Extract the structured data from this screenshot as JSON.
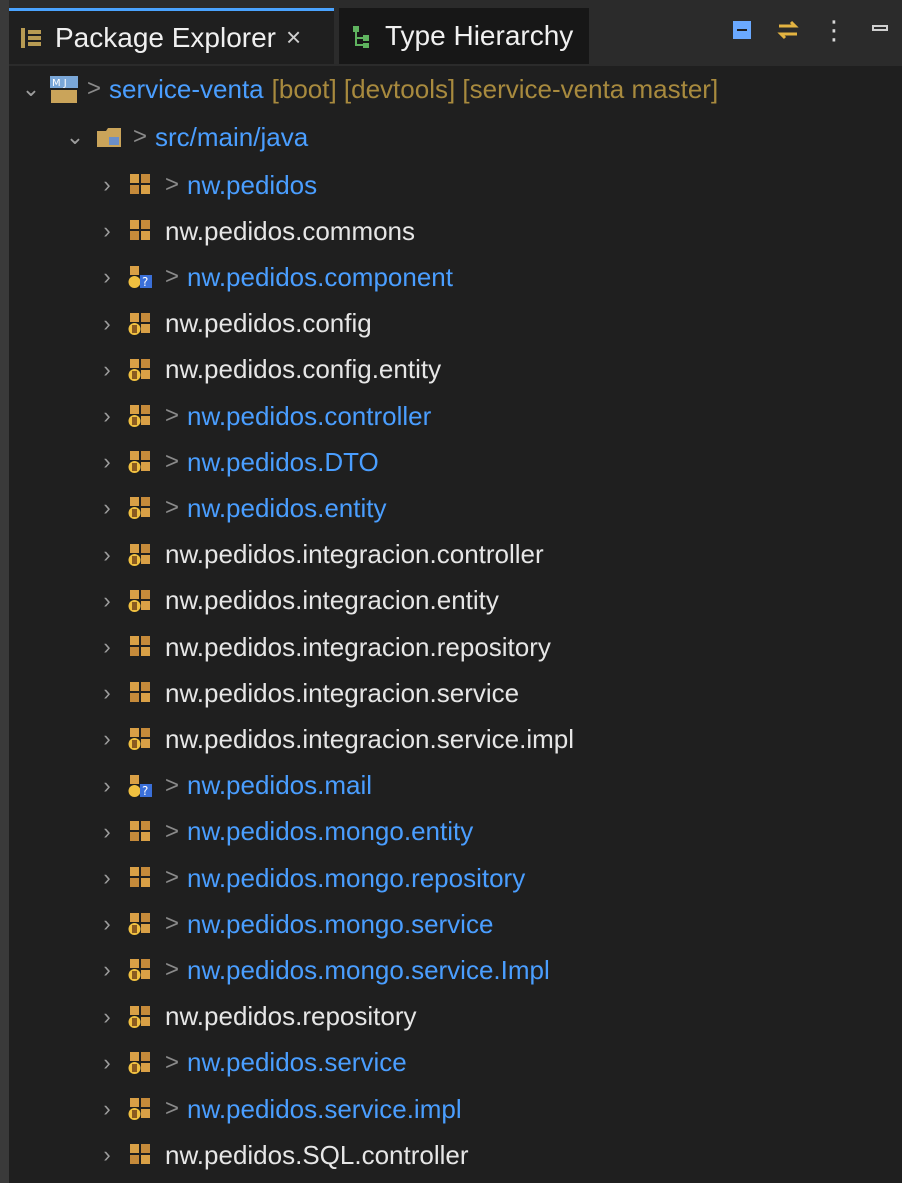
{
  "tabs": [
    {
      "label": "Package Explorer",
      "active": true
    },
    {
      "label": "Type Hierarchy",
      "active": false
    }
  ],
  "project": {
    "name": "service-venta",
    "decorations": "[boot] [devtools] [service-venta master]",
    "dirty_marker": ">"
  },
  "source_folder": {
    "name": "src/main/java",
    "dirty_marker": ">"
  },
  "packages": [
    {
      "name": "nw.pedidos",
      "dirty": true,
      "icon": "package-plain-icon"
    },
    {
      "name": "nw.pedidos.commons",
      "dirty": false,
      "icon": "package-plain-icon"
    },
    {
      "name": "nw.pedidos.component",
      "dirty": true,
      "icon": "package-question-icon"
    },
    {
      "name": "nw.pedidos.config",
      "dirty": false,
      "icon": "package-java-icon"
    },
    {
      "name": "nw.pedidos.config.entity",
      "dirty": false,
      "icon": "package-java-icon"
    },
    {
      "name": "nw.pedidos.controller",
      "dirty": true,
      "icon": "package-java-icon"
    },
    {
      "name": "nw.pedidos.DTO",
      "dirty": true,
      "icon": "package-java-icon"
    },
    {
      "name": "nw.pedidos.entity",
      "dirty": true,
      "icon": "package-java-icon"
    },
    {
      "name": "nw.pedidos.integracion.controller",
      "dirty": false,
      "icon": "package-java-icon"
    },
    {
      "name": "nw.pedidos.integracion.entity",
      "dirty": false,
      "icon": "package-java-icon"
    },
    {
      "name": "nw.pedidos.integracion.repository",
      "dirty": false,
      "icon": "package-plain-icon"
    },
    {
      "name": "nw.pedidos.integracion.service",
      "dirty": false,
      "icon": "package-plain-icon"
    },
    {
      "name": "nw.pedidos.integracion.service.impl",
      "dirty": false,
      "icon": "package-java-icon"
    },
    {
      "name": "nw.pedidos.mail",
      "dirty": true,
      "icon": "package-question-icon"
    },
    {
      "name": "nw.pedidos.mongo.entity",
      "dirty": true,
      "icon": "package-plain-icon"
    },
    {
      "name": "nw.pedidos.mongo.repository",
      "dirty": true,
      "icon": "package-plain-icon"
    },
    {
      "name": "nw.pedidos.mongo.service",
      "dirty": true,
      "icon": "package-java-icon"
    },
    {
      "name": "nw.pedidos.mongo.service.Impl",
      "dirty": true,
      "icon": "package-java-icon"
    },
    {
      "name": "nw.pedidos.repository",
      "dirty": false,
      "icon": "package-java-icon"
    },
    {
      "name": "nw.pedidos.service",
      "dirty": true,
      "icon": "package-java-icon"
    },
    {
      "name": "nw.pedidos.service.impl",
      "dirty": true,
      "icon": "package-java-icon"
    },
    {
      "name": "nw.pedidos.SQL.controller",
      "dirty": false,
      "icon": "package-plain-icon"
    }
  ],
  "colors": {
    "accent": "#4aa3ff",
    "modified": "#4a9eff",
    "decor": "#a88a3e",
    "background": "#1f1f1f"
  }
}
